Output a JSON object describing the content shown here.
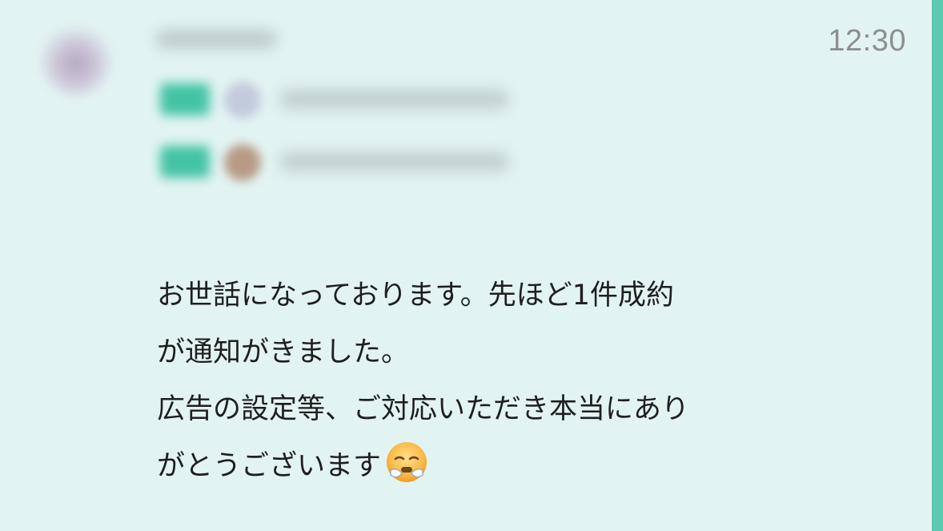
{
  "message": {
    "timestamp": "12:30",
    "body_lines": [
      "お世話になっております。先ほど1件成約",
      "が通知がきました。",
      "広告の設定等、ご対応いただき本当にあり",
      "がとうございます"
    ],
    "trailing_emoji": "crying-face-emoji"
  },
  "colors": {
    "background": "#e2f4f2",
    "accent_bar": "#5cc9b3",
    "timestamp_text": "#8e8e8e",
    "body_text": "#1f1f1f"
  }
}
